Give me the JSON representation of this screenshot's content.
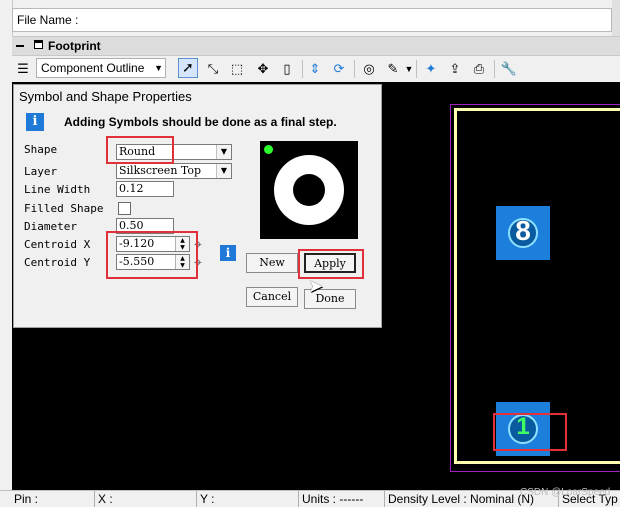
{
  "file_name_label": "File Name :",
  "footprint_panel": {
    "title": "Footprint"
  },
  "toolbar": {
    "layer_combo": "Component Outline"
  },
  "dialog": {
    "title": "Symbol and Shape Properties",
    "info_message": "Adding Symbols should be done as a final step.",
    "labels": {
      "shape": "Shape",
      "layer": "Layer",
      "line_width": "Line Width",
      "filled_shape": "Filled Shape",
      "diameter": "Diameter",
      "centroid_x": "Centroid X",
      "centroid_y": "Centroid Y"
    },
    "values": {
      "shape": "Round",
      "layer": "Silkscreen Top",
      "line_width": "0.12",
      "filled_shape": false,
      "diameter": "0.50",
      "centroid_x": "-9.120",
      "centroid_y": "-5.550"
    },
    "buttons": {
      "new": "New",
      "apply": "Apply",
      "cancel": "Cancel",
      "done": "Done"
    }
  },
  "canvas": {
    "pads": [
      "8",
      "1"
    ]
  },
  "status_bar": {
    "pin": "Pin :",
    "x": "X :",
    "y": "Y :",
    "units": "Units : ------",
    "density": "Density Level :  Nominal (N)",
    "select": "Select Typ"
  },
  "watermark": "CSDN @LoarSpeed",
  "colors": {
    "canvas_bg": "#000000",
    "pad_blue": "#1c7fdc",
    "outline_yellow": "#ffffb0",
    "highlight_red": "#e0303a",
    "accent_info": "#1e7ad6"
  }
}
